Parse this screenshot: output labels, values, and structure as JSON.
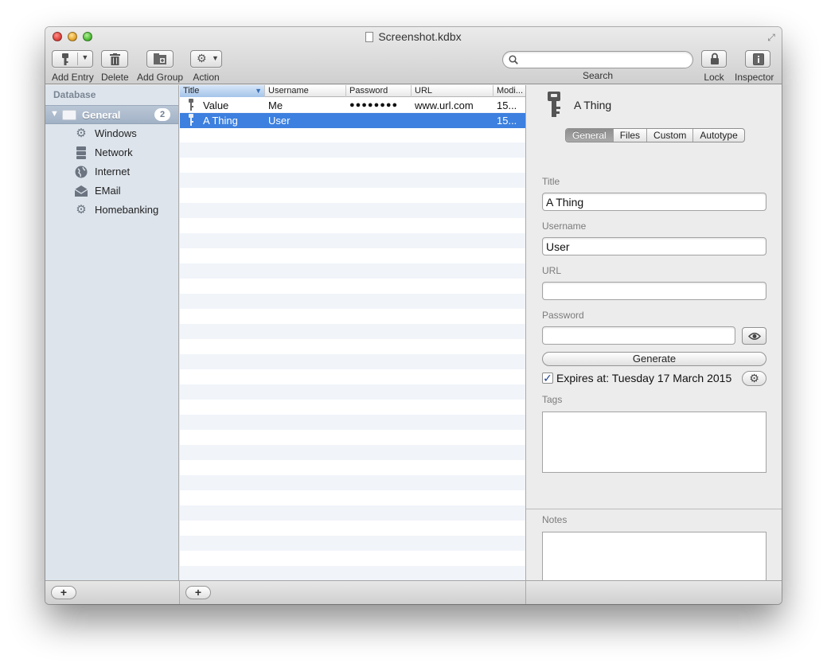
{
  "window": {
    "title": "Screenshot.kdbx"
  },
  "toolbar": {
    "add_entry": "Add Entry",
    "delete": "Delete",
    "add_group": "Add Group",
    "action": "Action",
    "search_label": "Search",
    "search_placeholder": "",
    "lock": "Lock",
    "inspector": "Inspector"
  },
  "sidebar": {
    "header": "Database",
    "group": {
      "label": "General",
      "count": "2"
    },
    "items": [
      {
        "label": "Windows",
        "icon": "gear-icon"
      },
      {
        "label": "Network",
        "icon": "server-icon"
      },
      {
        "label": "Internet",
        "icon": "globe-icon"
      },
      {
        "label": "EMail",
        "icon": "envelope-icon"
      },
      {
        "label": "Homebanking",
        "icon": "gear-icon"
      }
    ]
  },
  "table": {
    "columns": [
      "Title",
      "Username",
      "Password",
      "URL",
      "Modi..."
    ],
    "rows": [
      {
        "title": "Value",
        "username": "Me",
        "password": "●●●●●●●●",
        "url": "www.url.com",
        "modified": "15..."
      },
      {
        "title": "A Thing",
        "username": "User",
        "password": "",
        "url": "",
        "modified": "15..."
      }
    ],
    "selected_row": 1
  },
  "inspector": {
    "entry_title": "A Thing",
    "tabs": [
      "General",
      "Files",
      "Custom",
      "Autotype"
    ],
    "active_tab": "General",
    "fields": {
      "title_label": "Title",
      "title_value": "A Thing",
      "username_label": "Username",
      "username_value": "User",
      "url_label": "URL",
      "url_value": "",
      "password_label": "Password",
      "password_value": ""
    },
    "generate_label": "Generate",
    "expires_label": "Expires at: Tuesday 17 March 2015",
    "tags_label": "Tags",
    "notes_label": "Notes"
  },
  "colors": {
    "selection": "#3d80df",
    "sidebar_bg": "#dde4ec",
    "group_row": "#a2b2c6"
  }
}
